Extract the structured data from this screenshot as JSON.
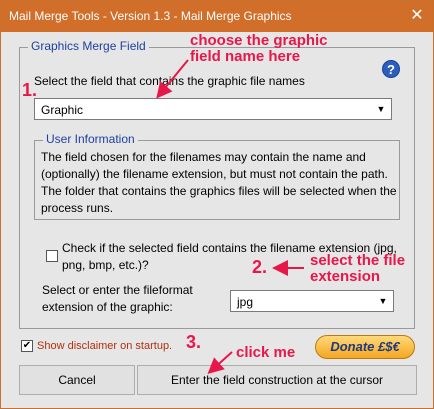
{
  "window": {
    "title": "Mail Merge Tools - Version 1.3 - Mail Merge Graphics",
    "close_glyph": "✕"
  },
  "group": {
    "legend": "Graphics Merge Field",
    "help_glyph": "?",
    "field_label": "Select the field that contains the graphic file names",
    "field_value": "Graphic"
  },
  "info": {
    "legend": "User Information",
    "text": "The field chosen for the filenames may contain the name and (optionally) the filename extension, but must not contain the path. The folder that contains the graphics files will be selected when the process runs."
  },
  "extension": {
    "checkbox_label": "Check if the selected field contains the filename extension (jpg, png, bmp, etc.)?",
    "checked": false,
    "format_label": "Select or enter the fileformat extension of the graphic:",
    "format_value": "jpg"
  },
  "disclaimer": {
    "label": "Show disclaimer on startup.",
    "checked": true,
    "check_glyph": "✔"
  },
  "donate": {
    "label": "Donate £$€"
  },
  "buttons": {
    "cancel": "Cancel",
    "enter": "Enter the field construction at the cursor"
  },
  "annotations": {
    "step1_num": "1.",
    "step1_text": "choose the graphic field name here",
    "step2_num": "2.",
    "step2_text": "select the file extension",
    "step3_num": "3.",
    "step3_text": "click me",
    "color": "#e8174a"
  },
  "colors": {
    "titlebar": "#d06e2a",
    "legend_text": "#1f3fa0",
    "disclaimer_text": "#b03010"
  }
}
